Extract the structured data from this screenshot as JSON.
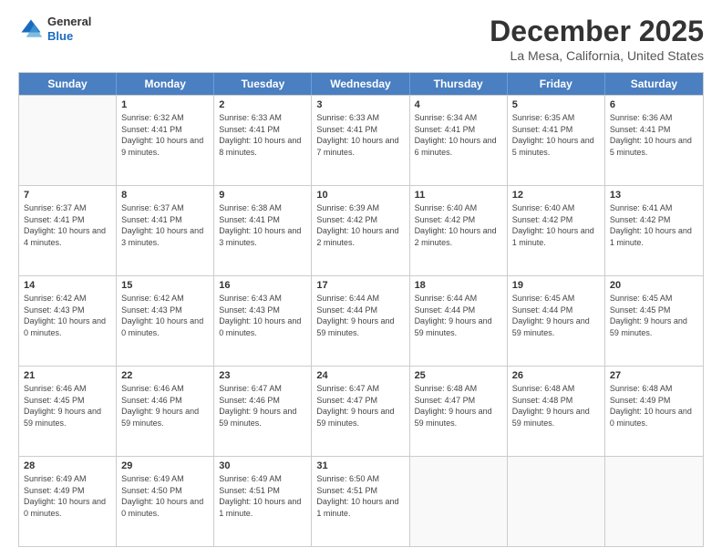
{
  "header": {
    "logo_general": "General",
    "logo_blue": "Blue",
    "title": "December 2025",
    "subtitle": "La Mesa, California, United States"
  },
  "days_of_week": [
    "Sunday",
    "Monday",
    "Tuesday",
    "Wednesday",
    "Thursday",
    "Friday",
    "Saturday"
  ],
  "weeks": [
    [
      {
        "day": "",
        "empty": true
      },
      {
        "day": "1",
        "sunrise": "6:32 AM",
        "sunset": "4:41 PM",
        "daylight": "10 hours and 9 minutes."
      },
      {
        "day": "2",
        "sunrise": "6:33 AM",
        "sunset": "4:41 PM",
        "daylight": "10 hours and 8 minutes."
      },
      {
        "day": "3",
        "sunrise": "6:33 AM",
        "sunset": "4:41 PM",
        "daylight": "10 hours and 7 minutes."
      },
      {
        "day": "4",
        "sunrise": "6:34 AM",
        "sunset": "4:41 PM",
        "daylight": "10 hours and 6 minutes."
      },
      {
        "day": "5",
        "sunrise": "6:35 AM",
        "sunset": "4:41 PM",
        "daylight": "10 hours and 5 minutes."
      },
      {
        "day": "6",
        "sunrise": "6:36 AM",
        "sunset": "4:41 PM",
        "daylight": "10 hours and 5 minutes."
      }
    ],
    [
      {
        "day": "7",
        "sunrise": "6:37 AM",
        "sunset": "4:41 PM",
        "daylight": "10 hours and 4 minutes."
      },
      {
        "day": "8",
        "sunrise": "6:37 AM",
        "sunset": "4:41 PM",
        "daylight": "10 hours and 3 minutes."
      },
      {
        "day": "9",
        "sunrise": "6:38 AM",
        "sunset": "4:41 PM",
        "daylight": "10 hours and 3 minutes."
      },
      {
        "day": "10",
        "sunrise": "6:39 AM",
        "sunset": "4:42 PM",
        "daylight": "10 hours and 2 minutes."
      },
      {
        "day": "11",
        "sunrise": "6:40 AM",
        "sunset": "4:42 PM",
        "daylight": "10 hours and 2 minutes."
      },
      {
        "day": "12",
        "sunrise": "6:40 AM",
        "sunset": "4:42 PM",
        "daylight": "10 hours and 1 minute."
      },
      {
        "day": "13",
        "sunrise": "6:41 AM",
        "sunset": "4:42 PM",
        "daylight": "10 hours and 1 minute."
      }
    ],
    [
      {
        "day": "14",
        "sunrise": "6:42 AM",
        "sunset": "4:43 PM",
        "daylight": "10 hours and 0 minutes."
      },
      {
        "day": "15",
        "sunrise": "6:42 AM",
        "sunset": "4:43 PM",
        "daylight": "10 hours and 0 minutes."
      },
      {
        "day": "16",
        "sunrise": "6:43 AM",
        "sunset": "4:43 PM",
        "daylight": "10 hours and 0 minutes."
      },
      {
        "day": "17",
        "sunrise": "6:44 AM",
        "sunset": "4:44 PM",
        "daylight": "9 hours and 59 minutes."
      },
      {
        "day": "18",
        "sunrise": "6:44 AM",
        "sunset": "4:44 PM",
        "daylight": "9 hours and 59 minutes."
      },
      {
        "day": "19",
        "sunrise": "6:45 AM",
        "sunset": "4:44 PM",
        "daylight": "9 hours and 59 minutes."
      },
      {
        "day": "20",
        "sunrise": "6:45 AM",
        "sunset": "4:45 PM",
        "daylight": "9 hours and 59 minutes."
      }
    ],
    [
      {
        "day": "21",
        "sunrise": "6:46 AM",
        "sunset": "4:45 PM",
        "daylight": "9 hours and 59 minutes."
      },
      {
        "day": "22",
        "sunrise": "6:46 AM",
        "sunset": "4:46 PM",
        "daylight": "9 hours and 59 minutes."
      },
      {
        "day": "23",
        "sunrise": "6:47 AM",
        "sunset": "4:46 PM",
        "daylight": "9 hours and 59 minutes."
      },
      {
        "day": "24",
        "sunrise": "6:47 AM",
        "sunset": "4:47 PM",
        "daylight": "9 hours and 59 minutes."
      },
      {
        "day": "25",
        "sunrise": "6:48 AM",
        "sunset": "4:47 PM",
        "daylight": "9 hours and 59 minutes."
      },
      {
        "day": "26",
        "sunrise": "6:48 AM",
        "sunset": "4:48 PM",
        "daylight": "9 hours and 59 minutes."
      },
      {
        "day": "27",
        "sunrise": "6:48 AM",
        "sunset": "4:49 PM",
        "daylight": "10 hours and 0 minutes."
      }
    ],
    [
      {
        "day": "28",
        "sunrise": "6:49 AM",
        "sunset": "4:49 PM",
        "daylight": "10 hours and 0 minutes."
      },
      {
        "day": "29",
        "sunrise": "6:49 AM",
        "sunset": "4:50 PM",
        "daylight": "10 hours and 0 minutes."
      },
      {
        "day": "30",
        "sunrise": "6:49 AM",
        "sunset": "4:51 PM",
        "daylight": "10 hours and 1 minute."
      },
      {
        "day": "31",
        "sunrise": "6:50 AM",
        "sunset": "4:51 PM",
        "daylight": "10 hours and 1 minute."
      },
      {
        "day": "",
        "empty": true
      },
      {
        "day": "",
        "empty": true
      },
      {
        "day": "",
        "empty": true
      }
    ]
  ],
  "labels": {
    "sunrise_prefix": "Sunrise: ",
    "sunset_prefix": "Sunset: ",
    "daylight_prefix": "Daylight: "
  }
}
